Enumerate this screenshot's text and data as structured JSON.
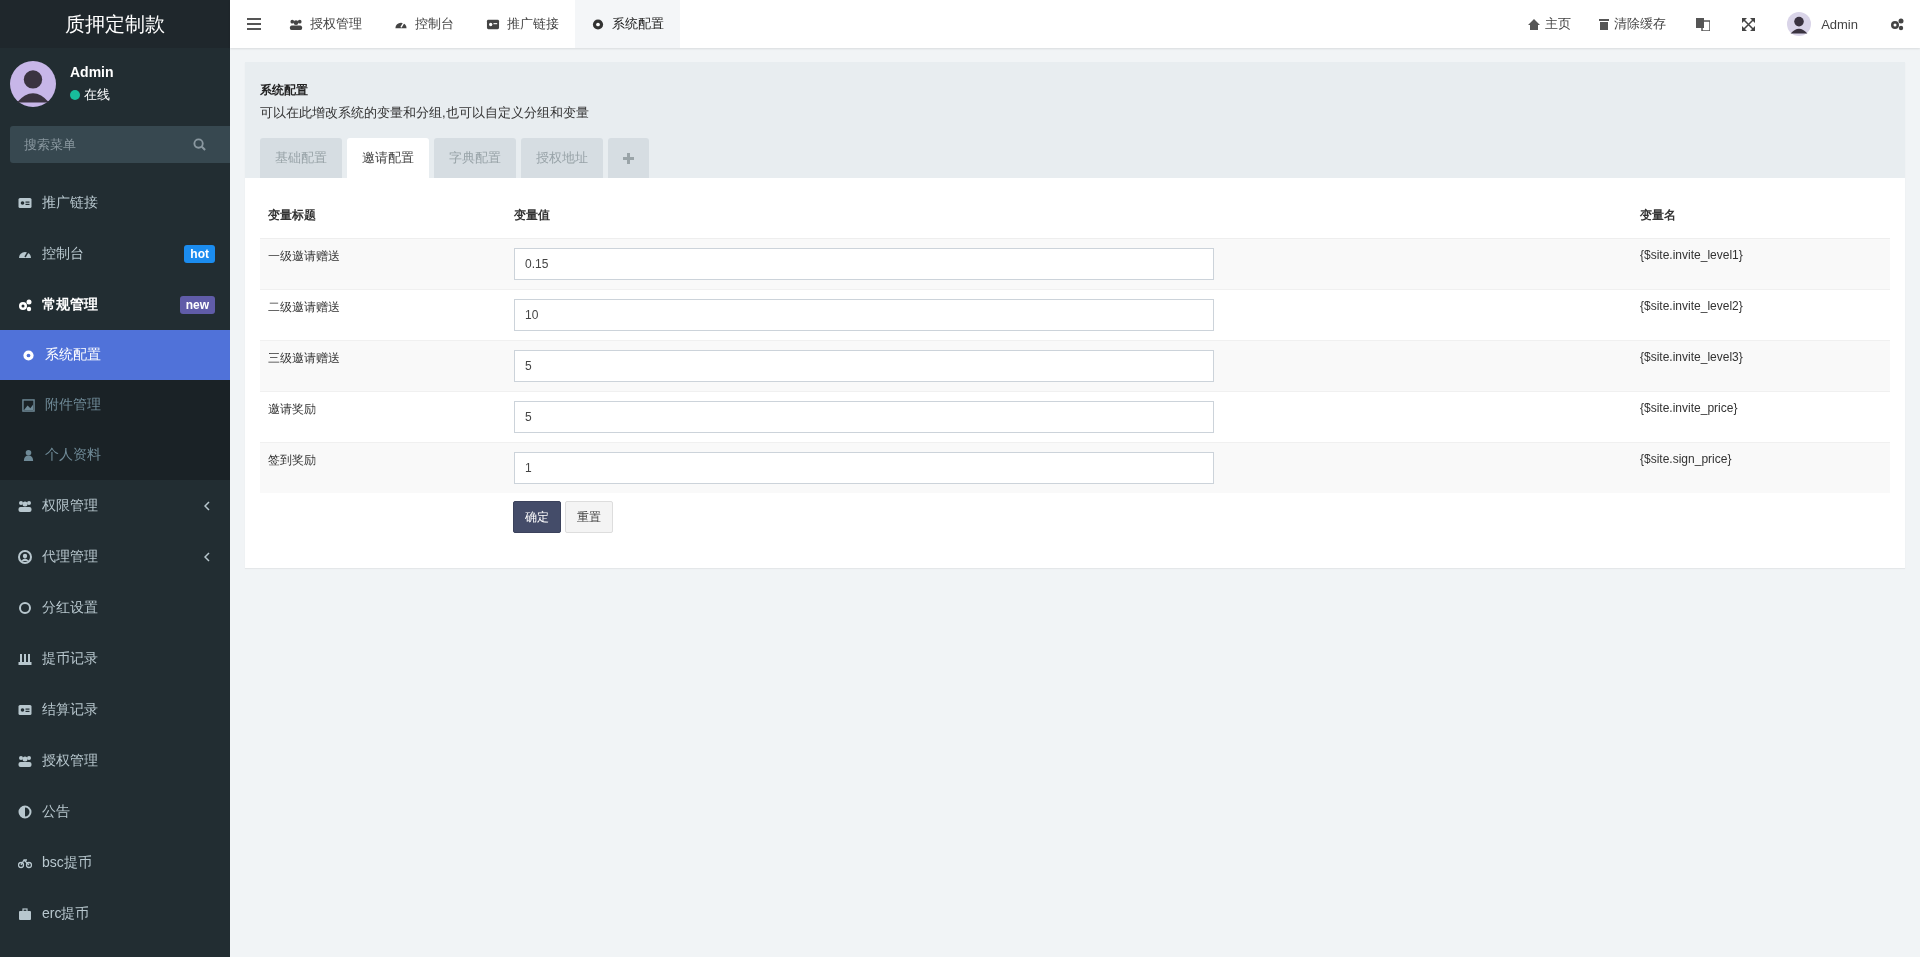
{
  "sidebar": {
    "logo": "质押定制款",
    "user": {
      "name": "Admin",
      "status": "在线"
    },
    "search": {
      "placeholder": "搜索菜单"
    },
    "items": [
      {
        "label": "推广链接",
        "selected": false
      },
      {
        "label": "控制台",
        "selected": false,
        "badge": {
          "text": "hot",
          "color": "#1b8cef"
        }
      },
      {
        "label": "常规管理",
        "selected": false,
        "expanded": true,
        "badge": {
          "text": "new",
          "color": "#605ca8"
        },
        "children": [
          {
            "label": "系统配置",
            "selected": true
          },
          {
            "label": "附件管理",
            "selected": false
          },
          {
            "label": "个人资料",
            "selected": false
          }
        ]
      },
      {
        "label": "权限管理",
        "selected": false,
        "expanded": false
      },
      {
        "label": "代理管理",
        "selected": false,
        "expanded": false
      },
      {
        "label": "分红设置",
        "selected": false
      },
      {
        "label": "提币记录",
        "selected": false
      },
      {
        "label": "结算记录",
        "selected": false
      },
      {
        "label": "授权管理",
        "selected": false
      },
      {
        "label": "公告",
        "selected": false
      },
      {
        "label": "bsc提币",
        "selected": false
      },
      {
        "label": "erc提币",
        "selected": false
      }
    ]
  },
  "topbar": {
    "tabs": [
      {
        "label": "授权管理",
        "selected": false
      },
      {
        "label": "控制台",
        "selected": false
      },
      {
        "label": "推广链接",
        "selected": false
      },
      {
        "label": "系统配置",
        "selected": true
      }
    ],
    "links": [
      "主页",
      "清除缓存"
    ],
    "user": "Admin"
  },
  "panel": {
    "title": "系统配置",
    "description": "可以在此增改系统的变量和分组,也可以自定义分组和变量",
    "tabs": [
      {
        "label": "基础配置",
        "selected": false
      },
      {
        "label": "邀请配置",
        "selected": true
      },
      {
        "label": "字典配置",
        "selected": false
      },
      {
        "label": "授权地址",
        "selected": false
      }
    ],
    "table": {
      "columns": [
        "变量标题",
        "变量值",
        "变量名"
      ],
      "rows": [
        {
          "title": "一级邀请赠送",
          "value": "0.15",
          "variable": "{$site.invite_level1}"
        },
        {
          "title": "二级邀请赠送",
          "value": "10",
          "variable": "{$site.invite_level2}"
        },
        {
          "title": "三级邀请赠送",
          "value": "5",
          "variable": "{$site.invite_level3}"
        },
        {
          "title": "邀请奖励",
          "value": "5",
          "variable": "{$site.invite_price}"
        },
        {
          "title": "签到奖励",
          "value": "1",
          "variable": "{$site.sign_price}"
        }
      ]
    },
    "buttons": [
      {
        "label": "确定",
        "kind": "primary"
      },
      {
        "label": "重置",
        "kind": "default"
      }
    ]
  }
}
